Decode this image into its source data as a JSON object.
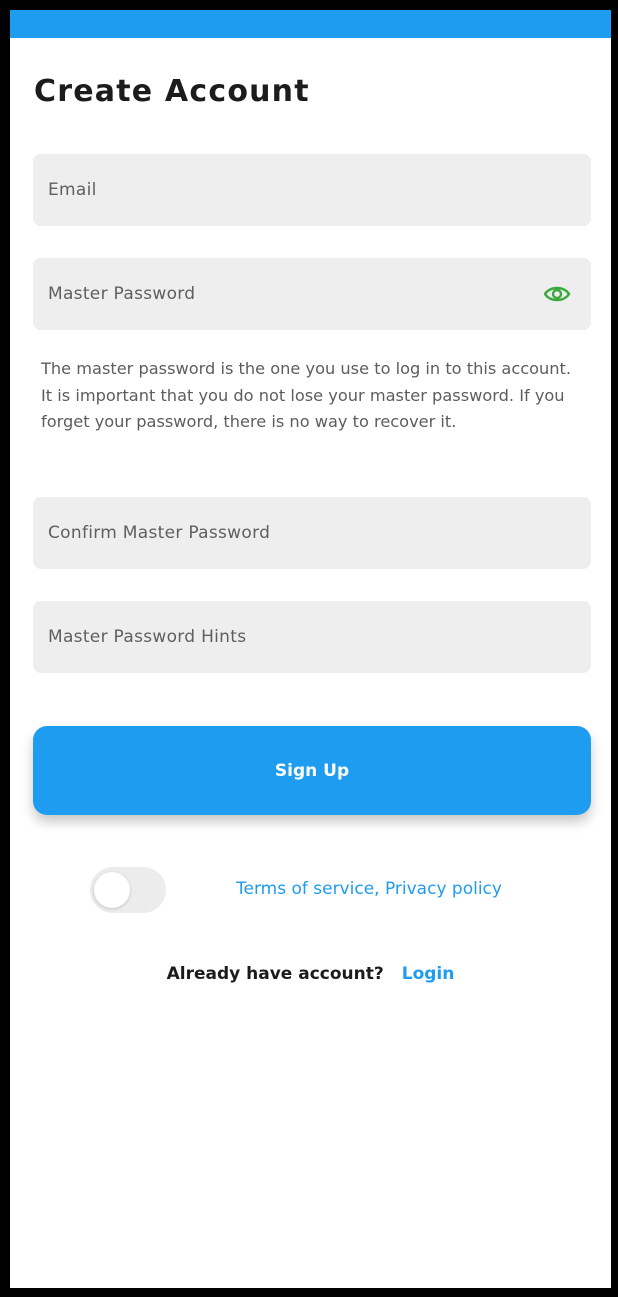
{
  "theme": {
    "accent": "#1e9cf0",
    "field_bg": "#eeeeee",
    "eye_icon": "#3aa83a"
  },
  "header": {
    "title": "Create Account"
  },
  "form": {
    "email": {
      "placeholder": "Email",
      "value": ""
    },
    "master_password": {
      "placeholder": "Master Password",
      "value": "",
      "icon": "eye-icon"
    },
    "helper": "The master password is the one you use to log in to this account. It is important that you do not lose your master password. If you forget your password, there is no way to recover it.",
    "confirm_password": {
      "placeholder": "Confirm Master Password",
      "value": ""
    },
    "password_hints": {
      "placeholder": "Master Password Hints",
      "value": ""
    }
  },
  "actions": {
    "signup_label": "Sign Up",
    "terms_toggle_on": false,
    "terms_label": "Terms of service, Privacy policy",
    "login_prompt": "Already have account?",
    "login_label": "Login"
  }
}
